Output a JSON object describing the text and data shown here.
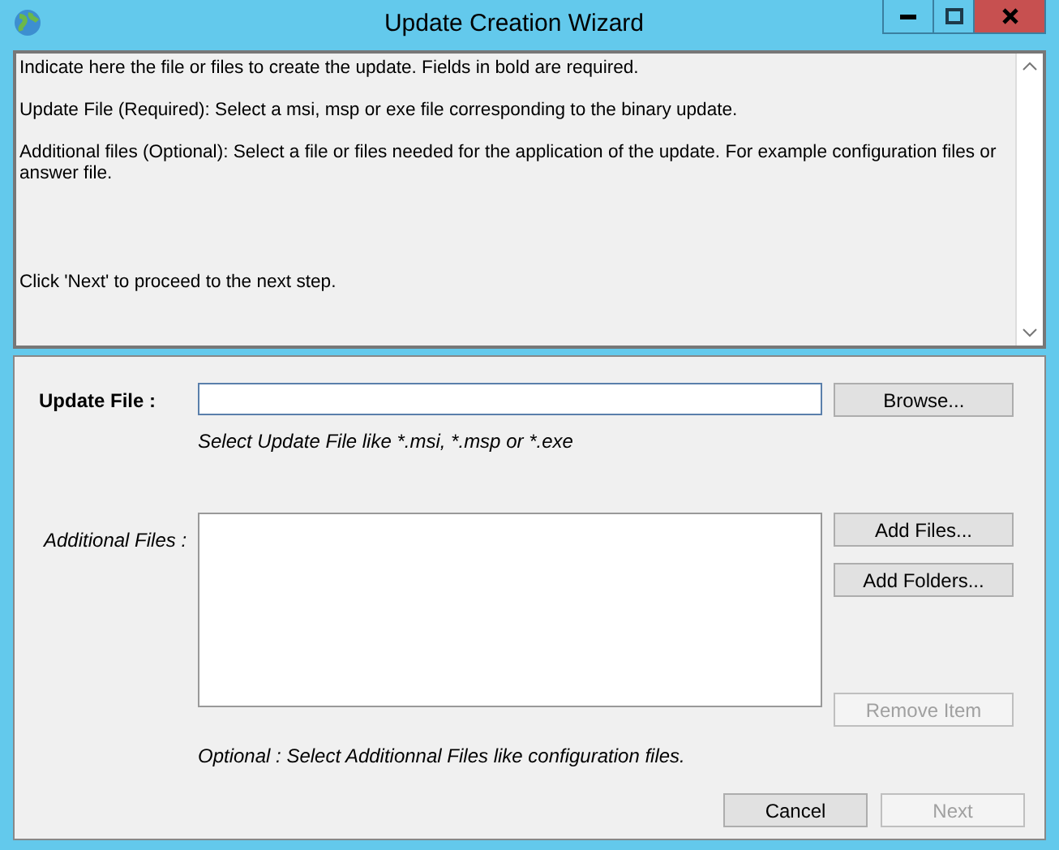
{
  "window": {
    "title": "Update Creation Wizard"
  },
  "info_lines": [
    "Indicate here the file or files to create the update. Fields in bold are required.",
    "Update File (Required): Select a msi, msp or exe file corresponding to the binary update.",
    "Additional files (Optional): Select a file or files needed for the application of the update. For example configuration files or answer file.",
    "Click 'Next' to proceed to the next step."
  ],
  "update_file": {
    "label": "Update File :",
    "hint": "Select Update File like *.msi, *.msp or *.exe",
    "button": {
      "label": "Browse...",
      "disabled": false
    }
  },
  "additional_files": {
    "label": "Additional Files :",
    "hint": "Optional : Select Additionnal Files like configuration files.",
    "buttons": [
      {
        "label": "Add Files...",
        "disabled": false
      },
      {
        "label": "Add Folders...",
        "disabled": false
      },
      {
        "label": "Remove Item",
        "disabled": true
      }
    ]
  },
  "footer_buttons": [
    {
      "label": "Cancel",
      "disabled": false
    },
    {
      "label": "Next",
      "disabled": true
    }
  ]
}
